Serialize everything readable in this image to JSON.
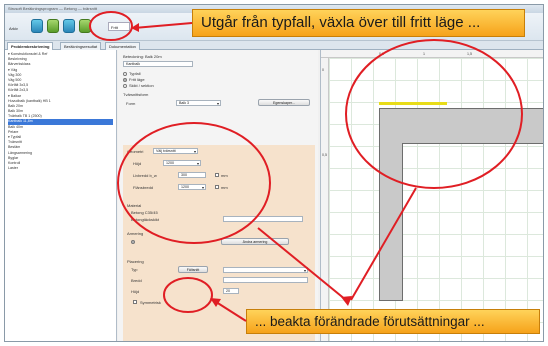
{
  "window": {
    "title": "Strusoft Beräkningsprogram — Betong — tvärsnitt"
  },
  "toolbar": {
    "mode_value": "Fritt",
    "buttons": [
      "Arkiv",
      "Ny",
      "Öppna",
      "Spara",
      "Skriv ut"
    ]
  },
  "tabs": [
    "Problembeskrivning",
    "Beräkningsresultat",
    "Dokumentation"
  ],
  "tree": {
    "items": [
      "▾ Konstruktionsdel & Ref",
      "   Beskrivning",
      "   Bärverksklass",
      "▾ Väg",
      "   Väg 300",
      "   Väg 500",
      "   Körfält 3x3,5",
      "   Körfält 2x3,5",
      "▾ Balkar",
      "   Huvudbalk (kantbalk) HB 1",
      "   Balk 20m",
      "   Balk 30m",
      "   Tvärbalk TB 1 (2500)",
      "   Kantbalk 11,8m",
      "   Balk 40m",
      "   Pelare",
      "▾ Typfall",
      "   Tvärsnitt",
      "   Bestäm",
      "   Längsarmering",
      "   Byglar",
      "   Kontroll",
      "Laster"
    ],
    "selected_index": 13
  },
  "form": {
    "title_label": "Beteckning: Balk 20m",
    "name_value": "Kantbalk",
    "radio_options": [
      "Typfall",
      "Fritt läge",
      "Skikt / sektion"
    ],
    "section_label": "Tvärsnittsform",
    "shape_label": "Form",
    "shape_value": "Balk 3",
    "prop_button": "Egenskaper...",
    "peach_title": "Geometri",
    "geom_select": "Välj tvärsnitt",
    "dim_rows": [
      {
        "label": "Höjd",
        "value": "1200",
        "unit": "mm"
      },
      {
        "label": "Livbredd b_w",
        "value": "300",
        "unit": "mm"
      },
      {
        "label": "Flänsbredd",
        "value": "1200",
        "unit": "mm"
      }
    ],
    "mat_title": "Material",
    "mat_value": "Betong C35/45",
    "concrete_label": "Betongtäckskikt",
    "armering_label": "Armering",
    "armering_button": "Ändra armering",
    "placering_title": "Placering",
    "typ_label": "Typ",
    "typ_value": "Fältsnitt",
    "bredd_label": "Bredd",
    "hojd_label": "Höjd",
    "hojd_value": "20",
    "checkbox_label": "Symmetrisk"
  },
  "canvas": {
    "ruler_top": [
      "0,5",
      "1",
      "1,5"
    ],
    "ruler_left": [
      "0",
      "0,5"
    ]
  },
  "callouts": {
    "top": "Utgår från typfall, växla över till fritt läge ...",
    "bottom": "... beakta förändrade förutsättningar ..."
  },
  "colors": {
    "callout_fill": "#f6b02a",
    "annotation_red": "#e01e24",
    "highlight": "#e8dc18"
  }
}
